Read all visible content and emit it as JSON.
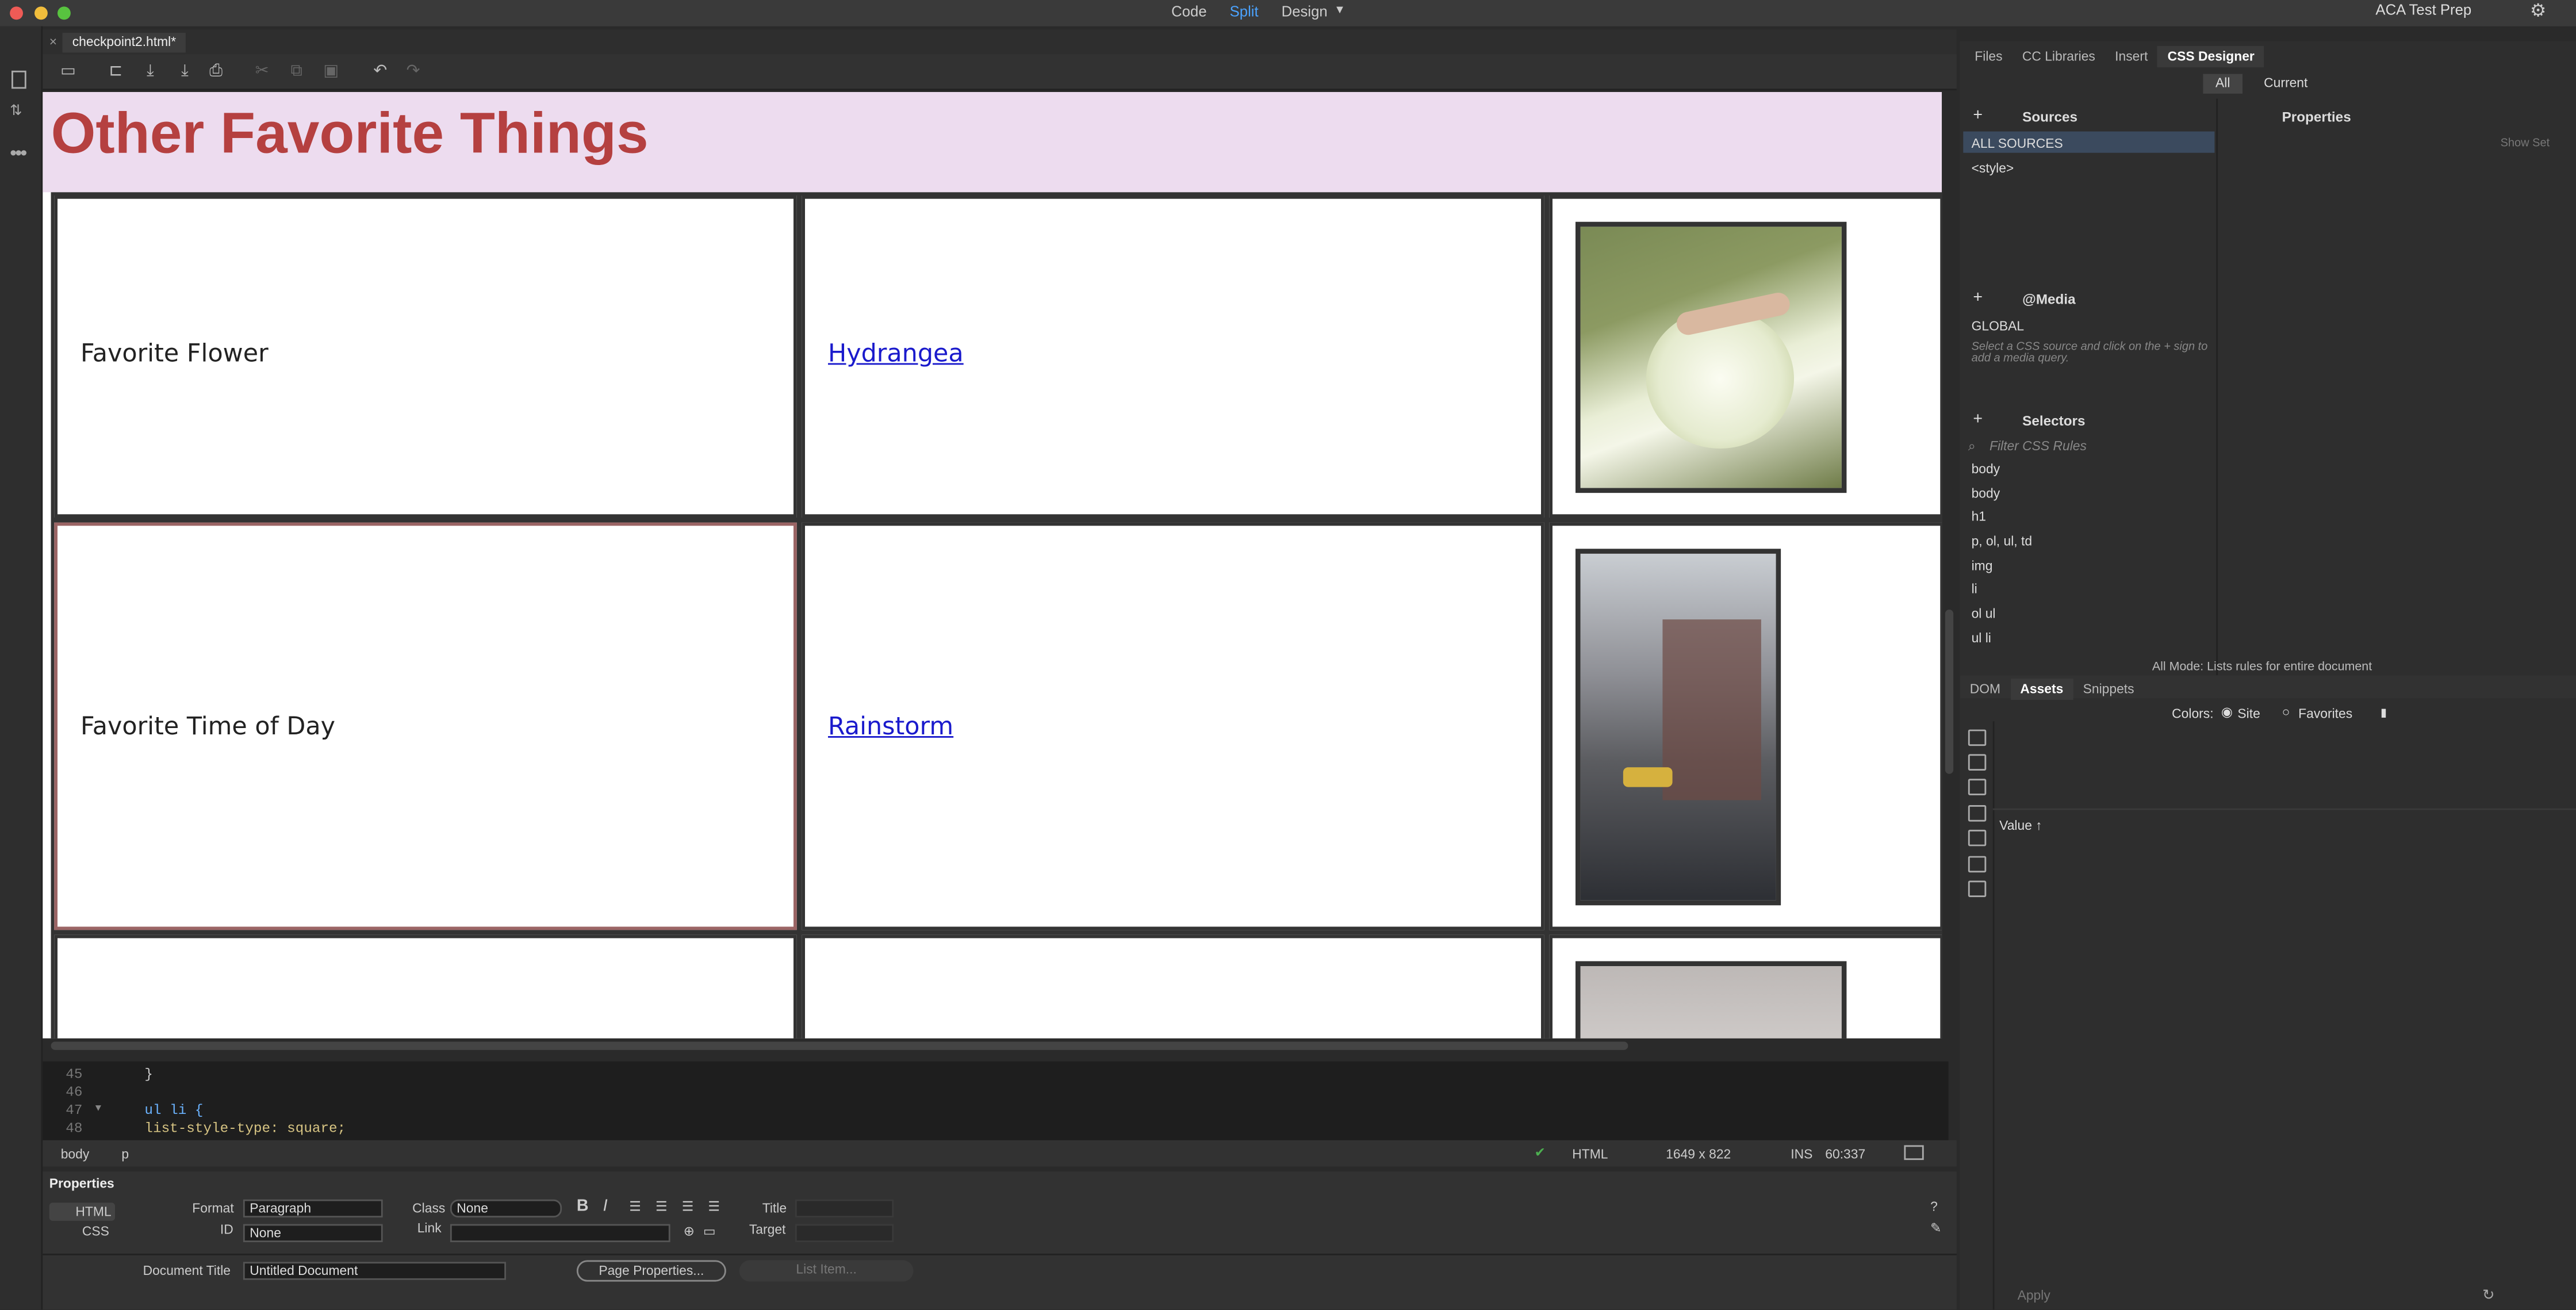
{
  "topbar": {
    "modes": [
      "Code",
      "Split",
      "Design"
    ],
    "workspace": "ACA Test Prep"
  },
  "document": {
    "tab_title": "checkpoint2.html*"
  },
  "design": {
    "heading": "Other Favorite Things",
    "rows": [
      {
        "label": "Favorite Flower",
        "link": "Hydrangea"
      },
      {
        "label": "Favorite Time of Day",
        "link": "Rainstorm"
      }
    ]
  },
  "code": {
    "lines": [
      {
        "num": "45",
        "text": "}"
      },
      {
        "num": "46",
        "text": ""
      },
      {
        "num": "47",
        "text": "ul  li {"
      },
      {
        "num": "48",
        "text": "  list-style-type: square;"
      }
    ]
  },
  "status": {
    "tags": [
      "body",
      "p"
    ],
    "doc_type": "HTML",
    "size": "1649 x 822",
    "mode": "INS",
    "position": "60:337"
  },
  "properties": {
    "title": "Properties",
    "html_btn": "HTML",
    "css_btn": "CSS",
    "format_label": "Format",
    "format_value": "Paragraph",
    "class_label": "Class",
    "class_value": "None",
    "id_label": "ID",
    "id_value": "None",
    "link_label": "Link",
    "title_label": "Title",
    "target_label": "Target",
    "doc_title_label": "Document Title",
    "doc_title_value": "Untitled Document",
    "page_props": "Page Properties...",
    "list_item": "List Item..."
  },
  "panel": {
    "tabs": [
      "Files",
      "CC Libraries",
      "Insert",
      "CSS Designer"
    ],
    "all": "All",
    "current": "Current",
    "sources": "Sources",
    "properties": "Properties",
    "all_sources": "ALL SOURCES",
    "style": "<style>",
    "show_set": "Show Set",
    "media": "@Media",
    "global": "GLOBAL",
    "media_hint": "Select a CSS source and click on the + sign to add a media query.",
    "selectors": "Selectors",
    "filter_placeholder": "Filter CSS Rules",
    "selector_items": [
      "body",
      "body",
      "h1",
      "p, ol, ul, td",
      "img",
      "li",
      "ol ul",
      "ul li"
    ],
    "mode_info": "All Mode: Lists rules for entire document",
    "lower_tabs": [
      "DOM",
      "Assets",
      "Snippets"
    ],
    "colors_label": "Colors:",
    "site": "Site",
    "favorites": "Favorites",
    "value_header": "Value ↑",
    "apply": "Apply"
  }
}
